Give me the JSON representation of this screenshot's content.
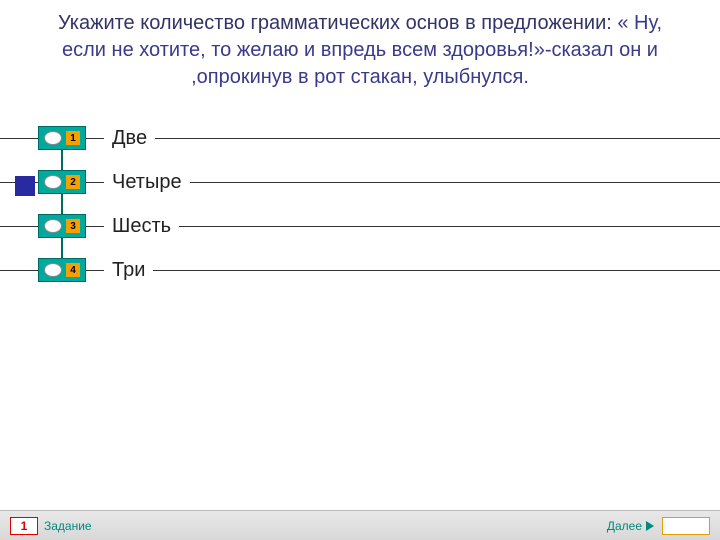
{
  "question": {
    "prompt": "Укажите количество грамматических основ в предложении: ",
    "sentence": "« Ну, если не хотите, то желаю и впредь всем здоровья!»-сказал он и ,опрокинув в рот стакан, улыбнулся."
  },
  "options": [
    {
      "num": "1",
      "label": "Две"
    },
    {
      "num": "2",
      "label": "Четыре"
    },
    {
      "num": "3",
      "label": "Шесть"
    },
    {
      "num": "4",
      "label": "Три"
    }
  ],
  "footer": {
    "task_number": "1",
    "task_label": "Задание",
    "next_label": "Далее"
  }
}
